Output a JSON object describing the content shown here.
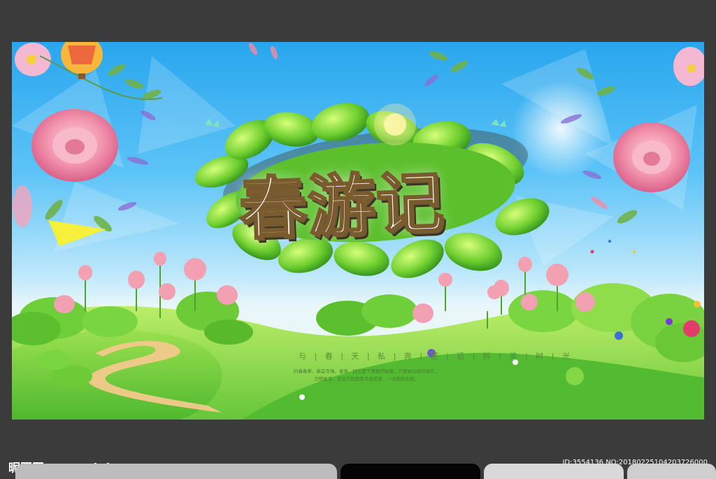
{
  "poster": {
    "title": "春游记",
    "slogan": "与 | 春 | 天 | 私 | 奔 | 邂 | 逅 | 醉 | 美 | 时 | 光",
    "blurb_line1": "约着春季、新品专场、春季、好比是个美丽的姑娘，只要她出现的地方，",
    "blurb_line2": "万物复苏，百花齐放都是鸟语花香、一派勃勃生机。"
  },
  "footer": {
    "site_logo": "昵图网 www.nipic.com",
    "image_id": "ID:3554136 NO:20180225104203726000"
  },
  "colors": {
    "sky_top": "#29a6ee",
    "grass": "#7bd13a",
    "title_outline": "#7a5b2e",
    "flower_pink": "#f07ea0"
  }
}
